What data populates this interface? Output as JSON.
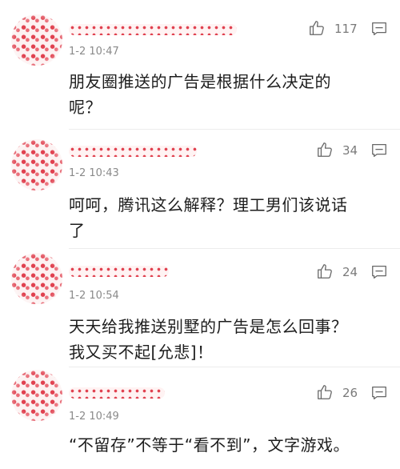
{
  "comments": [
    {
      "time": "1-2 10:47",
      "text_lines": [
        "朋友圈推送的广告是根据什么决定的",
        "呢？"
      ],
      "likes": "117",
      "username_visible": ":"
    },
    {
      "time": "1-2 10:43",
      "text_lines": [
        "呵呵，腾讯这么解释？理工男们该说话",
        "了"
      ],
      "likes": "34"
    },
    {
      "time": "1-2 10:54",
      "text_lines": [
        "天天给我推送别墅的广告是怎么回事？",
        "我又买不起[允悲]！"
      ],
      "likes": "24"
    },
    {
      "time": "1-2 10:49",
      "text_lines": [
        "“不留存”不等于“看不到”，文字游戏。"
      ],
      "likes": "26"
    }
  ],
  "icons": {
    "like": "thumbs-up-icon",
    "reply": "comment-icon"
  },
  "colors": {
    "text": "#1d1d1d",
    "meta": "#8a8a8a",
    "avatar_pattern": "#e0414f"
  }
}
